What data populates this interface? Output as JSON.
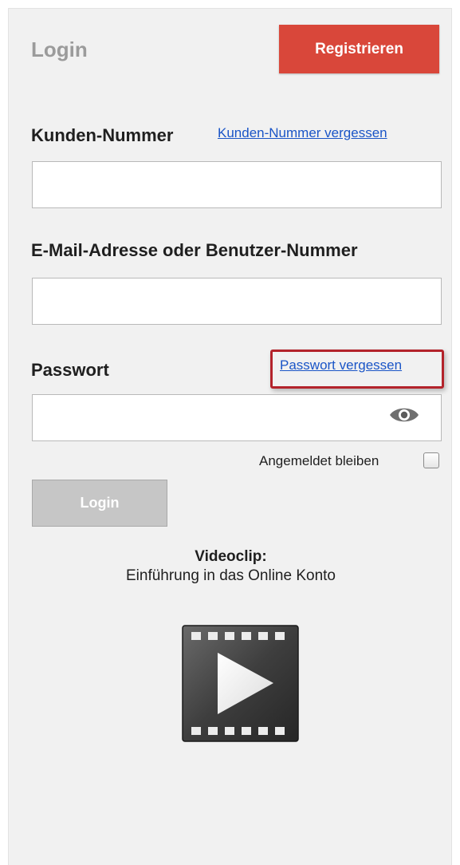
{
  "header": {
    "title": "Login",
    "register_label": "Registrieren"
  },
  "customer_number": {
    "label": "Kunden-Nummer",
    "forgot_link": "Kunden-Nummer vergessen",
    "value": ""
  },
  "email": {
    "label": "E-Mail-Adresse oder Benutzer-Nummer",
    "value": ""
  },
  "password": {
    "label": "Passwort",
    "forgot_link": "Passwort vergessen",
    "value": "",
    "toggle_icon": "eye-icon"
  },
  "remember": {
    "label": "Angemeldet bleiben",
    "checked": false
  },
  "login_button": {
    "label": "Login"
  },
  "video": {
    "title": "Videoclip:",
    "subtitle": "Einführung in das Online Konto",
    "icon": "video-play-icon"
  },
  "colors": {
    "register": "#d9473a",
    "link": "#1a55c7",
    "highlight": "#b3232b",
    "login_disabled": "#c6c6c6"
  }
}
